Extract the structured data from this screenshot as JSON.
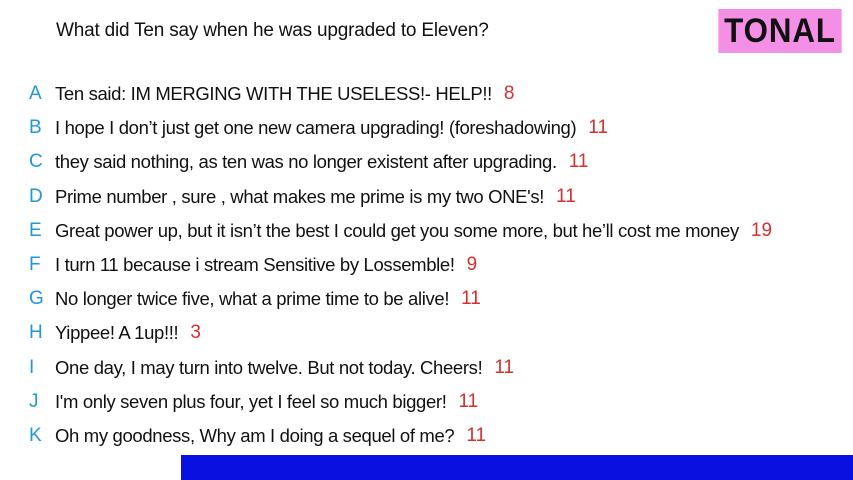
{
  "question": "What did Ten say when he was upgraded to Eleven?",
  "brand": {
    "label": "TONAL",
    "background": "#f48fe6",
    "color": "#111111"
  },
  "colors": {
    "letter": "#2196d9",
    "score": "#d32f2f",
    "bottom_bar": "#0a10e0"
  },
  "answers": [
    {
      "letter": "A",
      "text": "Ten said: IM MERGING WITH THE USELESS!- HELP!!",
      "score": "8"
    },
    {
      "letter": "B",
      "text": "I hope I don’t just get one new camera upgrading! (foreshadowing)",
      "score": "11"
    },
    {
      "letter": "C",
      "text": "they said nothing, as ten was no longer existent after upgrading.",
      "score": "11"
    },
    {
      "letter": "D",
      "text": "Prime number , sure , what makes me prime is my two ONE's!",
      "score": "11"
    },
    {
      "letter": "E",
      "text": "Great power up, but it isn’t the best I could get you some more, but he’ll cost me money",
      "score": "19"
    },
    {
      "letter": "F",
      "text": "I turn 11 because i stream Sensitive by Lossemble!",
      "score": "9"
    },
    {
      "letter": "G",
      "text": "No longer twice five, what a prime time to be alive!",
      "score": "11"
    },
    {
      "letter": "H",
      "text": "Yippee! A 1up!!!",
      "score": "3"
    },
    {
      "letter": "I",
      "text": "One day, I may turn into twelve. But not today. Cheers!",
      "score": "11"
    },
    {
      "letter": "J",
      "text": "I'm only seven plus four, yet I feel so much bigger!",
      "score": "11"
    },
    {
      "letter": "K",
      "text": "Oh my goodness, Why am I doing a sequel of me?",
      "score": "11"
    }
  ]
}
